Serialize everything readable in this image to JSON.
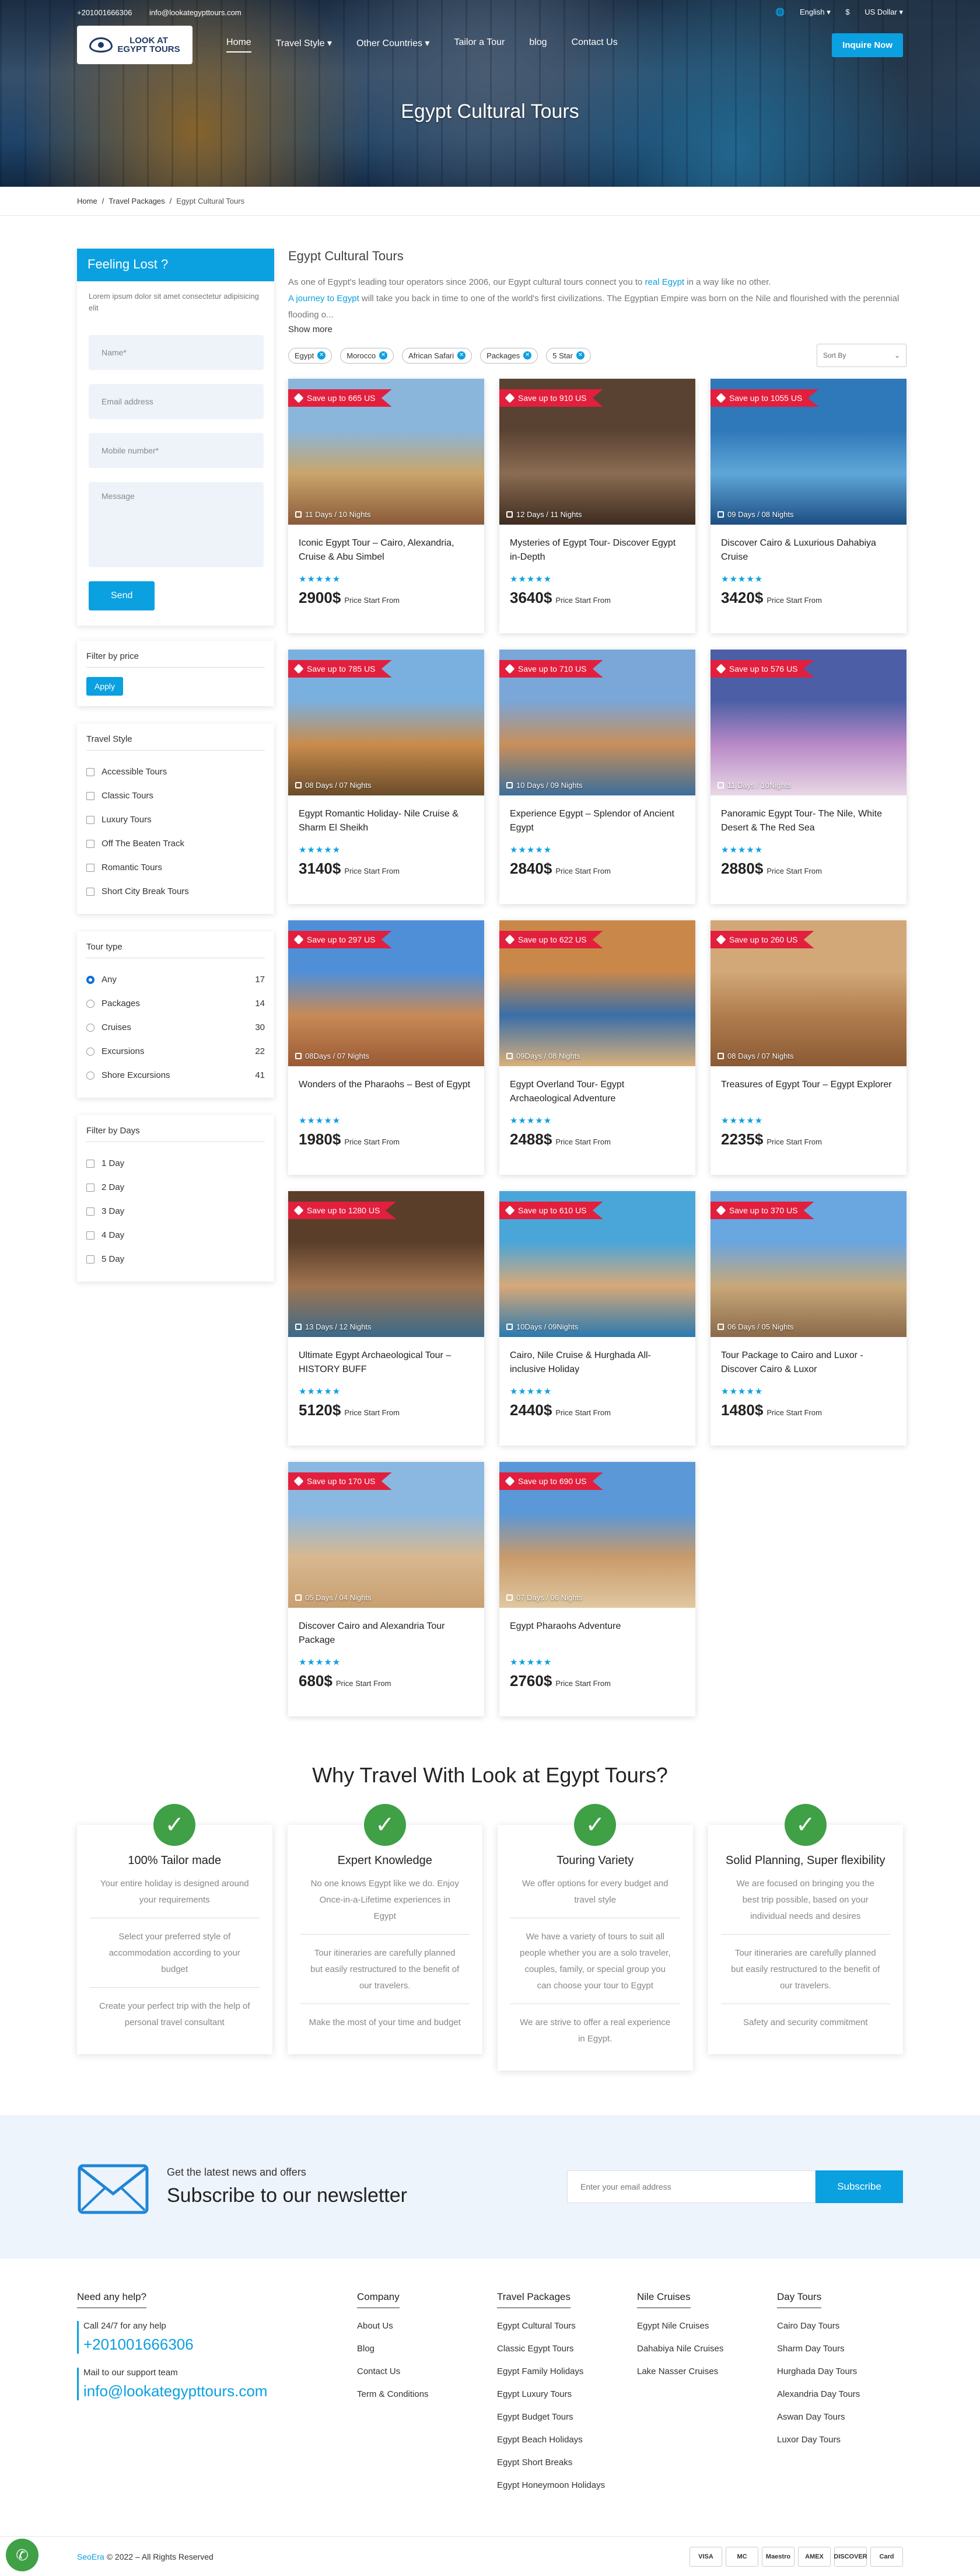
{
  "topbar": {
    "phone": "+201001666306",
    "email": "info@lookategypttours.com",
    "language": "English",
    "currency": "US Dollar"
  },
  "logo": {
    "line1": "LOOK AT",
    "line2": "EGYPT TOURS"
  },
  "nav": {
    "items": [
      "Home",
      "Travel Style",
      "Other Countries",
      "Tailor a Tour",
      "blog",
      "Contact Us"
    ],
    "inquire": "Inquire Now"
  },
  "hero": {
    "title": "Egypt Cultural Tours"
  },
  "breadcrumb": {
    "home": "Home",
    "packages": "Travel Packages",
    "current": "Egypt Cultural Tours"
  },
  "lost": {
    "title": "Feeling Lost ?",
    "text": "Lorem ipsum dolor sit amet consectetur adipisicing elit",
    "name": "Name*",
    "email": "Email address",
    "mobile": "Mobile number*",
    "message": "Message",
    "send": "Send"
  },
  "price_filter": {
    "title": "Filter by price",
    "apply": "Apply"
  },
  "travel_style": {
    "title": "Travel Style",
    "items": [
      "Accessible Tours",
      "Classic Tours",
      "Luxury Tours",
      "Off The Beaten Track",
      "Romantic Tours",
      "Short City Break Tours"
    ]
  },
  "tour_type": {
    "title": "Tour type",
    "items": [
      {
        "label": "Any",
        "count": "17"
      },
      {
        "label": "Packages",
        "count": "14"
      },
      {
        "label": "Cruises",
        "count": "30"
      },
      {
        "label": "Excursions",
        "count": "22"
      },
      {
        "label": "Shore Excursions",
        "count": "41"
      }
    ]
  },
  "days_filter": {
    "title": "Filter by Days",
    "items": [
      "1 Day",
      "2 Day",
      "3 Day",
      "4 Day",
      "5 Day"
    ]
  },
  "content": {
    "title": "Egypt Cultural Tours",
    "d1": "As one of Egypt's leading tour operators since 2006, our Egypt cultural tours connect you to ",
    "d1link": "real Egypt",
    "d2": " in a way like no other.",
    "d3link": "A journey to Egypt",
    "d4": " will take you back in time to one of the world's first civilizations. The Egyptian Empire was born on the Nile and flourished with the perennial flooding o...",
    "more": "Show more",
    "tags": [
      "Egypt",
      "Morocco",
      "African Safari",
      "Packages",
      "5 Star"
    ],
    "sort": "Sort By"
  },
  "tours": [
    {
      "save": "Save up to 665 US",
      "dur": "11 Days / 10 Nights",
      "title": "Iconic Egypt Tour – Cairo, Alexandria, Cruise & Abu Simbel",
      "price": "2900$",
      "img": [
        "#8ab6dc",
        "#c9a56a",
        "#8b5a3a"
      ]
    },
    {
      "save": "Save up to 910 US",
      "dur": "12 Days / 11 Nights",
      "title": "Mysteries of Egypt Tour- Discover Egypt in-Depth",
      "price": "3640$",
      "img": [
        "#5a4232",
        "#8a6c52",
        "#3e2c20"
      ]
    },
    {
      "save": "Save up to 1055 US",
      "dur": "09 Days / 08 Nights",
      "title": "Discover Cairo & Luxurious Dahabiya Cruise",
      "price": "3420$",
      "img": [
        "#2f78b9",
        "#5fa6d8",
        "#1d4f84"
      ]
    },
    {
      "save": "Save up to 785 US",
      "dur": "08 Days / 07 Nights",
      "title": "Egypt Romantic Holiday- Nile Cruise & Sharm El Sheikh",
      "price": "3140$",
      "img": [
        "#7ab0e0",
        "#c98c4c",
        "#6a4b2a"
      ]
    },
    {
      "save": "Save up to 710 US",
      "dur": "10 Days / 09 Nights",
      "title": "Experience Egypt – Splendor of Ancient Egypt",
      "price": "2840$",
      "img": [
        "#7aa6d8",
        "#c98f5a",
        "#3c6e9a"
      ]
    },
    {
      "save": "Save up to 576 US",
      "dur": "11 Days / 10Nights",
      "title": "Panoramic Egypt Tour- The Nile, White Desert & The Red Sea",
      "price": "2880$",
      "img": [
        "#4c5fa6",
        "#b889c6",
        "#e9d8e6"
      ]
    },
    {
      "save": "Save up to 297 US",
      "dur": "08Days / 07 Nights",
      "title": "Wonders of the Pharaohs – Best of Egypt",
      "price": "1980$",
      "img": [
        "#4f8fd8",
        "#c88a56",
        "#9a5a34"
      ]
    },
    {
      "save": "Save up to 622 US",
      "dur": "09Days / 08 Nights",
      "title": "Egypt Overland Tour- Egypt Archaeological Adventure",
      "price": "2488$",
      "img": [
        "#c9884a",
        "#3a6ea8",
        "#d9b07a"
      ]
    },
    {
      "save": "Save up to 260 US",
      "dur": "08 Days / 07 Nights",
      "title": "Treasures of Egypt Tour – Egypt Explorer",
      "price": "2235$",
      "img": [
        "#d2a878",
        "#b07d4e",
        "#8a5a34"
      ]
    },
    {
      "save": "Save up to 1280 US",
      "dur": "13 Days / 12 Nights",
      "title": "Ultimate Egypt Archaeological Tour – HISTORY BUFF",
      "price": "5120$",
      "img": [
        "#5a3e2a",
        "#a07450",
        "#3a6a8a"
      ]
    },
    {
      "save": "Save up to 610 US",
      "dur": "10Days / 09Nights",
      "title": "Cairo, Nile Cruise & Hurghada All-inclusive Holiday",
      "price": "2440$",
      "img": [
        "#4aa6d8",
        "#d8a878",
        "#2a7ab0"
      ]
    },
    {
      "save": "Save up to 370 US",
      "dur": "06 Days / 05 Nights",
      "title": "Tour Package to Cairo and Luxor - Discover Cairo & Luxor",
      "price": "1480$",
      "img": [
        "#6aa6e0",
        "#c8a878",
        "#8a6a4a"
      ]
    },
    {
      "save": "Save up to 170 US",
      "dur": "05 Days / 04 Nights",
      "title": "Discover Cairo and Alexandria Tour Package",
      "price": "680$",
      "img": [
        "#8ab8e0",
        "#d8b890",
        "#c8a070"
      ]
    },
    {
      "save": "Save up to 690 US",
      "dur": "07 Days / 06 Nights",
      "title": "Egypt Pharaohs Adventure",
      "price": "2760$",
      "img": [
        "#5a98d8",
        "#c89a6a",
        "#e0c8a0"
      ]
    }
  ],
  "price_note": "Price Start From",
  "why": {
    "title": "Why Travel With Look at Egypt Tours?",
    "cards": [
      {
        "title": "100% Tailor made",
        "p": [
          "Your entire holiday is designed around your requirements",
          "Select your preferred style of accommodation according to your budget",
          "Create your perfect trip with the help of personal travel consultant"
        ]
      },
      {
        "title": "Expert Knowledge",
        "p": [
          "No one knows Egypt like we do. Enjoy Once-in-a-Lifetime experiences in Egypt",
          "Tour itineraries are carefully planned but easily restructured to the benefit of our travelers.",
          "Make the most of your time and budget"
        ]
      },
      {
        "title": "Touring Variety",
        "p": [
          "We offer options for every budget and travel style",
          "We have a variety of tours to suit all people whether you are a solo traveler, couples, family, or special group you can choose your tour to Egypt",
          "We are strive to offer a real experience in Egypt."
        ]
      },
      {
        "title": "Solid Planning, Super flexibility",
        "p": [
          "We are focused on bringing you the best trip possible, based on your individual needs and desires",
          "Tour itineraries are carefully planned but easily restructured to the benefit of our travelers.",
          "Safety and security commitment"
        ]
      }
    ]
  },
  "newsletter": {
    "small": "Get the latest news and offers",
    "big": "Subscribe to our newsletter",
    "placeholder": "Enter your email address",
    "button": "Subscribe"
  },
  "footer": {
    "help": {
      "title": "Need any help?",
      "call": "Call 24/7 for any help",
      "phone": "+201001666306",
      "mail": "Mail to our support team",
      "email": "info@lookategypttours.com"
    },
    "company": {
      "title": "Company",
      "links": [
        "About Us",
        "Blog",
        "Contact Us",
        "Term & Conditions"
      ]
    },
    "packages": {
      "title": "Travel Packages",
      "links": [
        "Egypt Cultural Tours",
        "Classic Egypt Tours",
        "Egypt Family Holidays",
        "Egypt Luxury Tours",
        "Egypt Budget Tours",
        "Egypt Beach Holidays",
        "Egypt Short Breaks",
        "Egypt Honeymoon Holidays"
      ]
    },
    "nile": {
      "title": "Nile Cruises",
      "links": [
        "Egypt Nile Cruises",
        "Dahabiya Nile Cruises",
        "Lake Nasser Cruises"
      ]
    },
    "day": {
      "title": "Day Tours",
      "links": [
        "Cairo Day Tours",
        "Sharm Day Tours",
        "Hurghada Day Tours",
        "Alexandria Day Tours",
        "Aswan Day Tours",
        "Luxor Day Tours"
      ]
    }
  },
  "bottom": {
    "brand": "SeoEra",
    "copy": "© 2022 – All Rights Reserved",
    "cards": [
      "VISA",
      "MC",
      "Maestro",
      "AMEX",
      "DISCOVER",
      "Card"
    ]
  }
}
